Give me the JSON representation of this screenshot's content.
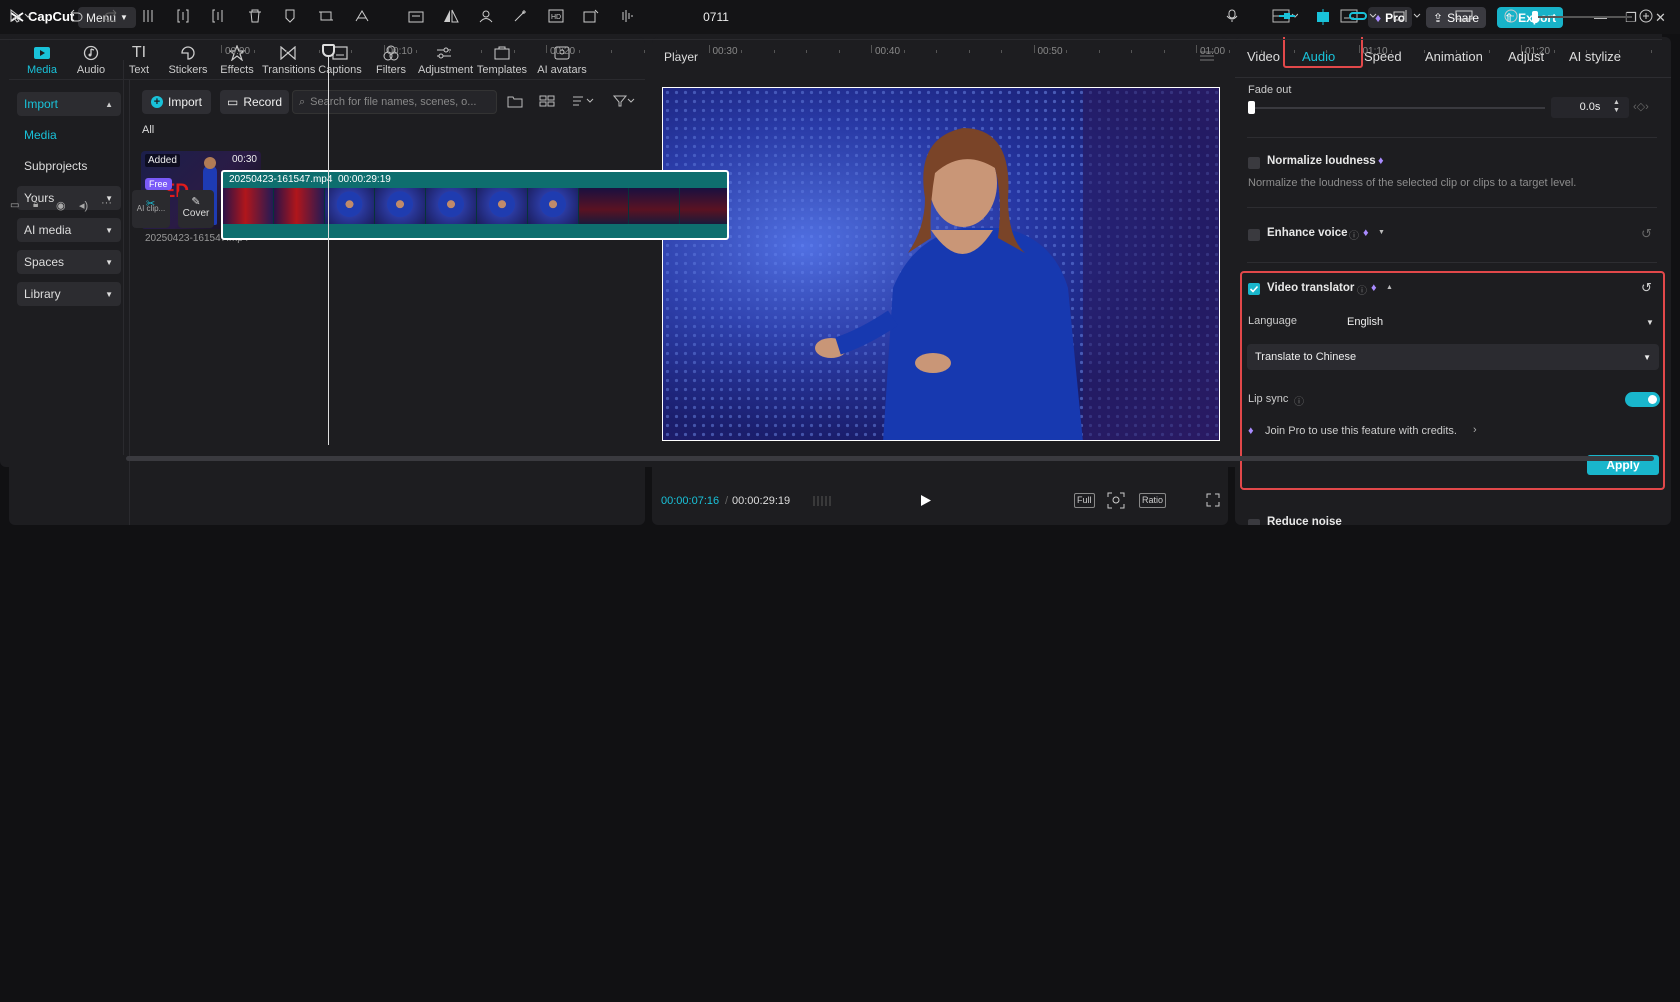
{
  "titlebar": {
    "app_name": "CapCut",
    "menu_label": "Menu",
    "project_title": "0711",
    "pro_label": "Pro",
    "share_label": "Share",
    "export_label": "Export"
  },
  "media_toolbar": {
    "tools": [
      {
        "label": "Media",
        "icon": "media-icon",
        "active": true
      },
      {
        "label": "Audio",
        "icon": "audio-icon"
      },
      {
        "label": "Text",
        "icon": "text-icon"
      },
      {
        "label": "Stickers",
        "icon": "stickers-icon"
      },
      {
        "label": "Effects",
        "icon": "effects-icon"
      },
      {
        "label": "Transitions",
        "icon": "transitions-icon"
      },
      {
        "label": "Captions",
        "icon": "captions-icon"
      },
      {
        "label": "Filters",
        "icon": "filters-icon"
      },
      {
        "label": "Adjustment",
        "icon": "adjustment-icon"
      },
      {
        "label": "Templates",
        "icon": "templates-icon"
      },
      {
        "label": "AI avatars",
        "icon": "ai-avatars-icon"
      }
    ]
  },
  "media_sidebar": {
    "items": [
      {
        "label": "Import",
        "active": true
      },
      {
        "label": "Media",
        "active": true
      },
      {
        "label": "Subprojects"
      },
      {
        "label": "Yours"
      },
      {
        "label": "AI media"
      },
      {
        "label": "Spaces"
      },
      {
        "label": "Library"
      }
    ]
  },
  "media_content": {
    "import_label": "Import",
    "record_label": "Record",
    "search_placeholder": "Search for file names, scenes, o...",
    "filter_all": "All",
    "thumb_added": "Added",
    "thumb_duration": "00:30",
    "thumb_filename": "20250423-161547.mp4"
  },
  "player": {
    "title": "Player",
    "current_time": "00:00:07:16",
    "total_time": "00:00:29:19",
    "full_label": "Full",
    "ratio_label": "Ratio"
  },
  "props": {
    "tabs": [
      {
        "label": "Video"
      },
      {
        "label": "Audio",
        "active": true
      },
      {
        "label": "Speed"
      },
      {
        "label": "Animation"
      },
      {
        "label": "Adjust"
      },
      {
        "label": "AI stylize"
      }
    ],
    "fade_out_label": "Fade out",
    "fade_out_value": "0.0s",
    "normalize_label": "Normalize loudness",
    "normalize_desc": "Normalize the loudness of the selected clip or clips to a target level.",
    "enhance_label": "Enhance voice",
    "translator_label": "Video translator",
    "language_label": "Language",
    "language_value": "English",
    "translate_value": "Translate to Chinese",
    "lip_sync_label": "Lip sync",
    "lip_sync_on": true,
    "pro_note": "Join Pro to use this feature with credits.",
    "apply_label": "Apply",
    "reduce_noise_label": "Reduce noise"
  },
  "timeline": {
    "ruler": [
      "00:00",
      "00:10",
      "00:20",
      "00:30",
      "00:40",
      "00:50",
      "01:00",
      "01:10",
      "01:20"
    ],
    "clip_name": "20250423-161547.mp4",
    "clip_duration": "00:00:29:19",
    "cover_label": "Cover",
    "free_badge": "Free",
    "ai_clip_label": "AI clip..."
  },
  "colors": {
    "accent": "#19c2d9",
    "highlight": "#e2484a",
    "pro": "#7a5af8"
  }
}
